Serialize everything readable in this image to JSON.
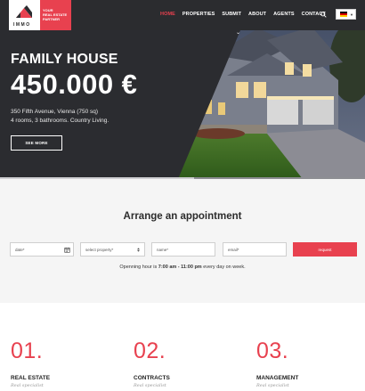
{
  "brand": {
    "logo_text": "IMMO",
    "tagline": [
      "YOUR",
      "REAL ESTATE",
      "PARTNER"
    ],
    "accent_color": "#e8414f"
  },
  "nav": {
    "items": [
      {
        "label": "HOME",
        "active": true
      },
      {
        "label": "PROPERTIES",
        "active": false
      },
      {
        "label": "SUBMIT",
        "active": false
      },
      {
        "label": "ABOUT",
        "active": false
      },
      {
        "label": "AGENTS",
        "active": false
      },
      {
        "label": "CONTACT",
        "active": false
      }
    ],
    "search_icon": "search-icon",
    "language": {
      "flag": "germany"
    }
  },
  "hero": {
    "title": "FAMILY HOUSE",
    "price": "450.000 €",
    "address": "350 Fifth Avenue, Vienna (750 sq)",
    "details": "4 rooms, 3 bathrooms. Country Living.",
    "button_label": "SEE MORE"
  },
  "appointment": {
    "title": "Arrange an appointment",
    "fields": {
      "date_placeholder": "date*",
      "property_placeholder": "select property*",
      "name_placeholder": "name*",
      "email_placeholder": "email*"
    },
    "request_label": "request",
    "opening_prefix": "Openning hour is ",
    "opening_hours": "7:00 am - 11:00 pm",
    "opening_suffix": " every day on week."
  },
  "services": [
    {
      "number": "01.",
      "title": "REAL ESTATE",
      "subtitle": "Real specialist"
    },
    {
      "number": "02.",
      "title": "CONTRACTS",
      "subtitle": "Real specialist"
    },
    {
      "number": "03.",
      "title": "MANAGEMENT",
      "subtitle": "Real specialist"
    }
  ]
}
